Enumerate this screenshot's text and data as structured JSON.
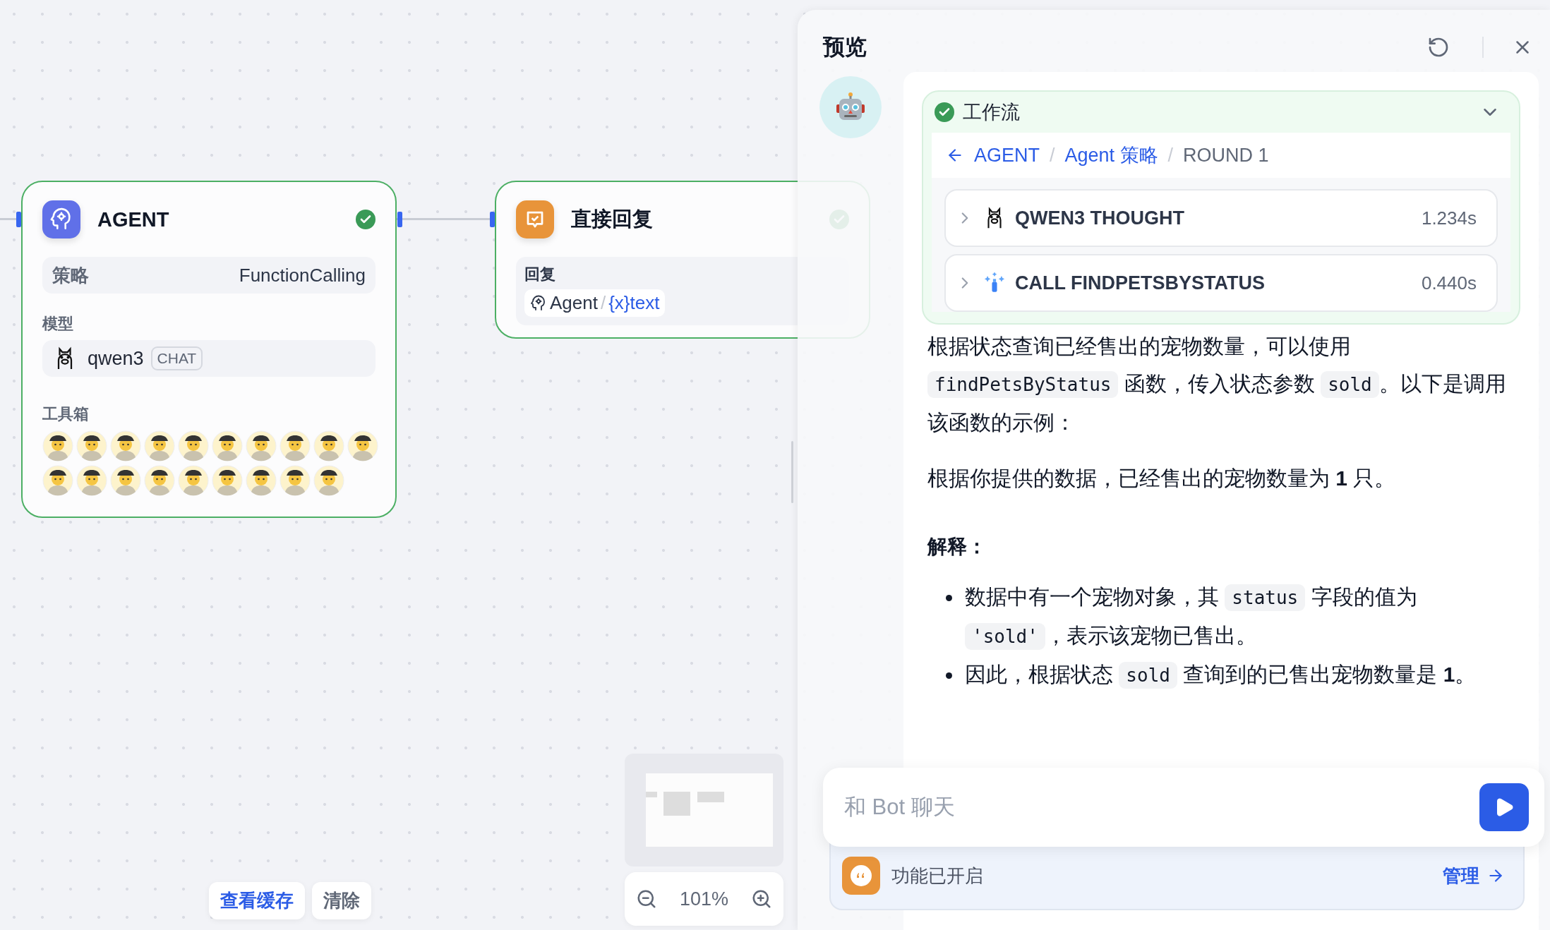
{
  "canvas": {
    "nodes": [
      {
        "kind": "agent",
        "title": "AGENT",
        "succeeded": true,
        "strategy": {
          "label": "策略",
          "value": "FunctionCalling"
        },
        "model": {
          "label": "模型",
          "name": "qwen3",
          "tag": "CHAT"
        },
        "toolbox": {
          "label": "工具箱"
        }
      },
      {
        "kind": "reply",
        "title": "直接回复",
        "succeeded": true,
        "field_label": "回复",
        "variable": {
          "source": "Agent",
          "separator": "/",
          "symbol": "{x}",
          "name": "text"
        }
      }
    ],
    "buttons": [
      {
        "label": "查看缓存",
        "primary": true
      },
      {
        "label": "清除",
        "primary": false
      }
    ],
    "zoom": {
      "value": "101%"
    }
  },
  "preview": {
    "title": "预览",
    "workflow": {
      "title": "工作流",
      "succeeded": true,
      "expanded": true,
      "breadcrumb_separator": "/",
      "breadcrumb": [
        {
          "label": "AGENT",
          "link": true
        },
        {
          "label": "Agent 策略",
          "link": true
        },
        {
          "label": "ROUND 1",
          "link": false
        }
      ],
      "steps": [
        {
          "kind": "llm",
          "label": "QWEN3 THOUGHT",
          "time": "1.234s",
          "expanded": false
        },
        {
          "kind": "tool",
          "label": "CALL FINDPETSBYSTATUS",
          "time": "0.440s",
          "expanded": false
        }
      ]
    },
    "message": [
      {
        "kind": "paragraph",
        "segments": [
          {
            "text": "根据状态查询已经售出的宠物数量，可以使用 ",
            "code": false
          },
          {
            "text": "findPetsByStatus",
            "code": true
          },
          {
            "text": " 函数，传入状态参数 ",
            "code": false
          },
          {
            "text": "sold",
            "code": true
          },
          {
            "text": "。以下是调用该函数的示例：",
            "code": false
          }
        ]
      },
      {
        "kind": "paragraph",
        "segments": [
          {
            "text": "根据你提供的数据，已经售出的宠物数量为 **1** 只。",
            "code": false
          }
        ]
      },
      {
        "kind": "heading",
        "text": "解释："
      },
      {
        "kind": "list",
        "items": [
          {
            "segments": [
              {
                "text": "数据中有一个宠物对象，其 ",
                "code": false
              },
              {
                "text": "status",
                "code": true
              },
              {
                "text": " 字段的值为 ",
                "code": false
              },
              {
                "text": "'sold'",
                "code": true
              },
              {
                "text": "，表示该宠物已售出。",
                "code": false
              }
            ]
          },
          {
            "segments": [
              {
                "text": "因此，根据状态 ",
                "code": false
              },
              {
                "text": "sold",
                "code": true
              },
              {
                "text": " 查询到的已售出宠物数量是 **1**。",
                "code": false
              }
            ]
          }
        ]
      }
    ],
    "input": {
      "placeholder": "和 Bot 聊天"
    },
    "feature": {
      "text": "功能已开启",
      "link": "管理"
    }
  }
}
